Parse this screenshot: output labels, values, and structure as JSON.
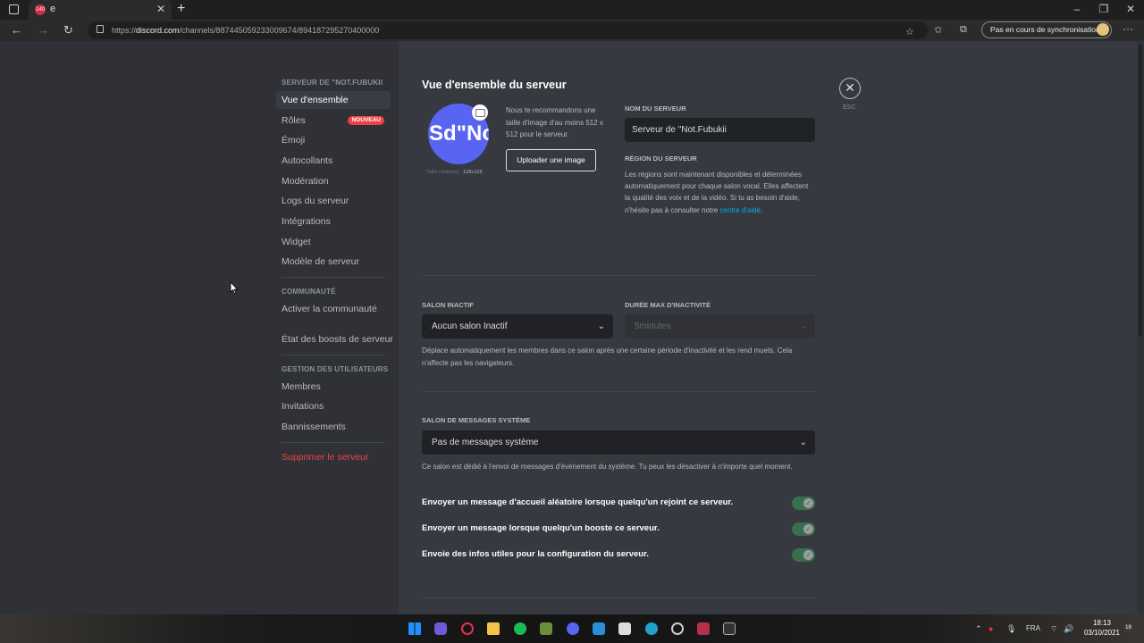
{
  "browser": {
    "tab_badge": "140",
    "tab_title": "e",
    "url_prefix": "https://",
    "url_domain": "discord.com",
    "url_path": "/channels/887445059233009674/894187295270400000",
    "sync_label": "Pas en cours de synchronisation"
  },
  "sidebar": {
    "server_section": "SERVEUR DE \"Not.Fubukii",
    "items": [
      {
        "label": "Vue d'ensemble"
      },
      {
        "label": "Rôles",
        "badge": "NOUVEAU"
      },
      {
        "label": "Émoji"
      },
      {
        "label": "Autocollants"
      },
      {
        "label": "Modération"
      },
      {
        "label": "Logs du serveur"
      },
      {
        "label": "Intégrations"
      },
      {
        "label": "Widget"
      },
      {
        "label": "Modèle de serveur"
      }
    ],
    "community_section": "COMMUNAUTÉ",
    "community_items": [
      {
        "label": "Activer la communauté"
      },
      {
        "label": "État des boosts de serveur"
      }
    ],
    "users_section": "GESTION DES UTILISATEURS",
    "users_items": [
      {
        "label": "Membres"
      },
      {
        "label": "Invitations"
      },
      {
        "label": "Bannissements"
      }
    ],
    "delete_label": "Supprimer le serveur"
  },
  "overview": {
    "title": "Vue d'ensemble du serveur",
    "close_label": "ESC",
    "icon_text": "Sd\"No",
    "min_size_label": "Taille minimum :",
    "min_size_value": "128x128",
    "recommend_text": "Nous te recommandons une taille d'image d'au moins 512 x 512 pour le serveur.",
    "upload_label": "Uploader une image",
    "name_label": "NOM DU SERVEUR",
    "name_value": "Serveur de \"Not.Fubukii",
    "region_label": "RÉGION DU SERVEUR",
    "region_text": "Les régions sont maintenant disponibles et déterminées automatiquement pour chaque salon vocal. Elles affectent la qualité des voix et de la vidéo. Si tu as besoin d'aide, n'hésite pas à consulter notre",
    "region_link": "centre d'aide",
    "region_end": "."
  },
  "inactive": {
    "channel_label": "SALON INACTIF",
    "channel_value": "Aucun salon Inactif",
    "timeout_label": "DURÉE MAX D'INACTIVITÉ",
    "timeout_value": "5minutes",
    "help": "Déplace automatiquement les membres dans ce salon après une certaine période d'inactivité et les rend muets. Cela n'affecte pas les navigateurs."
  },
  "system": {
    "label": "SALON DE MESSAGES SYSTÈME",
    "value": "Pas de messages système",
    "help": "Ce salon est dédié à l'envoi de messages d'événement du système. Tu peux les désactiver à n'importe quel moment.",
    "toggles": [
      {
        "label": "Envoyer un message d'accueil aléatoire lorsque quelqu'un rejoint ce serveur.",
        "on": true
      },
      {
        "label": "Envoyer un message lorsque quelqu'un booste ce serveur.",
        "on": true
      },
      {
        "label": "Envoie des infos utiles pour la configuration du serveur.",
        "on": true
      }
    ]
  },
  "taskbar": {
    "lang": "FRA",
    "time": "18:13",
    "date": "03/10/2021",
    "notifications": "18"
  },
  "colors": {
    "accent": "#5865f2",
    "danger": "#ed4245",
    "toggle_on": "#3ba55d",
    "link": "#00aff4"
  }
}
